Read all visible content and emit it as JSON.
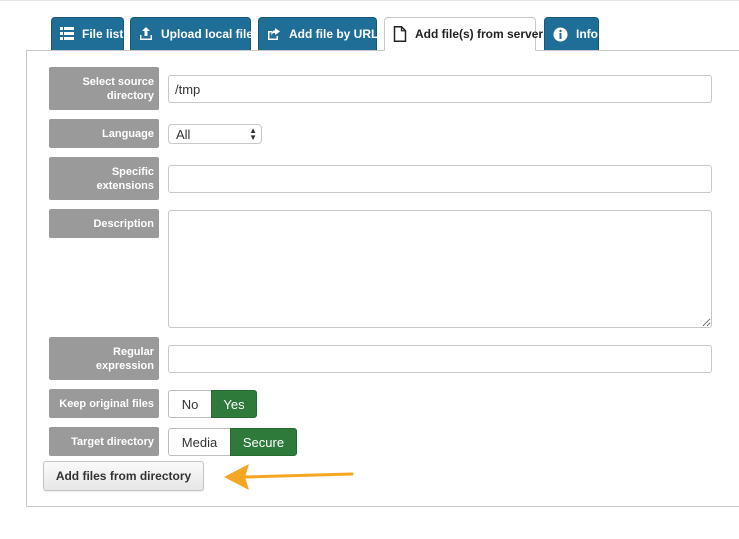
{
  "tabs": [
    {
      "label": "File list",
      "icon": "list-icon"
    },
    {
      "label": "Upload local file",
      "icon": "upload-icon"
    },
    {
      "label": "Add file by URL",
      "icon": "share-icon"
    },
    {
      "label": "Add file(s) from server",
      "icon": "file-icon",
      "active": true
    },
    {
      "label": "Info",
      "icon": "info-icon"
    }
  ],
  "form": {
    "source_dir": {
      "label": "Select source directory",
      "value": "/tmp"
    },
    "language": {
      "label": "Language",
      "value": "All"
    },
    "extensions": {
      "label": "Specific extensions",
      "value": ""
    },
    "description": {
      "label": "Description",
      "value": ""
    },
    "regex": {
      "label": "Regular expression",
      "value": ""
    },
    "keep_original": {
      "label": "Keep original files",
      "options": [
        "No",
        "Yes"
      ],
      "selected": "Yes"
    },
    "target_dir": {
      "label": "Target directory",
      "options": [
        "Media",
        "Secure"
      ],
      "selected": "Secure"
    }
  },
  "submit_label": "Add files from directory",
  "colors": {
    "tab_blue": "#1f6e97",
    "label_gray": "#9a9a9a",
    "toggle_green": "#2e7a3a",
    "arrow_orange": "#f5a623"
  }
}
